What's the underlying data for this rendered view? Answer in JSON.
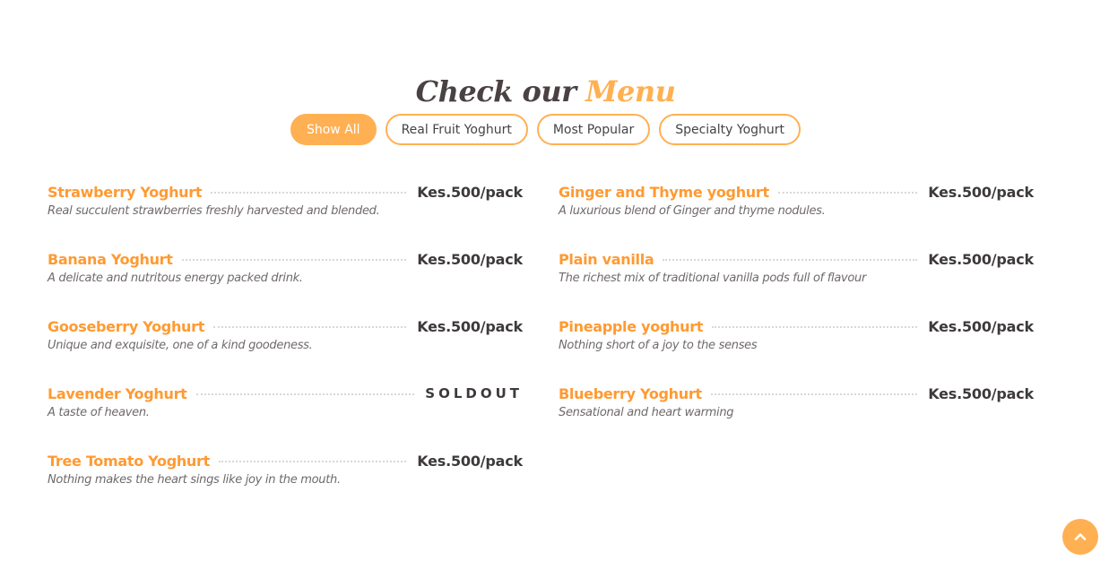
{
  "section_title": {
    "prefix": "Check our",
    "accent": "Menu"
  },
  "filters": [
    {
      "label": "Show All",
      "active": true
    },
    {
      "label": "Real Fruit Yoghurt",
      "active": false
    },
    {
      "label": "Most Popular",
      "active": false
    },
    {
      "label": "Specialty Yoghurt",
      "active": false
    }
  ],
  "menu_items": [
    {
      "name": "Strawberry Yoghurt",
      "price": "Kes.500/pack",
      "description": "Real succulent strawberries freshly harvested and blended."
    },
    {
      "name": "Ginger and Thyme yoghurt",
      "price": "Kes.500/pack",
      "description": "A luxurious blend of Ginger and thyme nodules."
    },
    {
      "name": "Banana Yoghurt",
      "price": "Kes.500/pack",
      "description": "A delicate and nutritous energy packed drink."
    },
    {
      "name": "Plain vanilla",
      "price": "Kes.500/pack",
      "description": "The richest mix of traditional vanilla pods full of flavour"
    },
    {
      "name": "Gooseberry Yoghurt",
      "price": "Kes.500/pack",
      "description": "Unique and exquisite, one of a kind goodeness."
    },
    {
      "name": "Pineapple yoghurt",
      "price": "Kes.500/pack",
      "description": "Nothing short of a joy to the senses"
    },
    {
      "name": "Lavender Yoghurt",
      "price": "SOLDOUT",
      "description": "A taste of heaven."
    },
    {
      "name": "Blueberry Yoghurt",
      "price": "Kes.500/pack",
      "description": "Sensational and heart warming"
    },
    {
      "name": "Tree Tomato Yoghurt",
      "price": "Kes.500/pack",
      "description": "Nothing makes the heart sings like joy in the mouth."
    }
  ],
  "back_to_top": {
    "icon": "chevron-up-icon"
  },
  "colors": {
    "accent": "#ffb052",
    "item_name": "#ff9a32",
    "heading": "#4a4142",
    "price": "#3e3a3a",
    "description": "#706a6a"
  }
}
